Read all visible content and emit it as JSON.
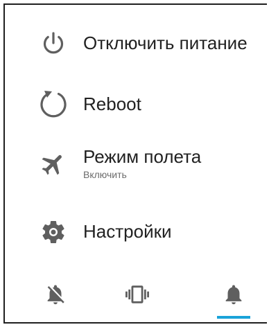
{
  "power_menu": {
    "items": [
      {
        "label": "Отключить питание",
        "icon": "power-icon"
      },
      {
        "label": "Reboot",
        "icon": "reboot-icon"
      },
      {
        "label": "Режим полета",
        "sublabel": "Включить",
        "icon": "airplane-icon"
      },
      {
        "label": "Настройки",
        "icon": "settings-icon"
      }
    ],
    "sound_modes": [
      {
        "name": "silent",
        "icon": "bell-off-icon"
      },
      {
        "name": "vibrate",
        "icon": "vibrate-icon"
      },
      {
        "name": "sound",
        "icon": "bell-icon",
        "selected": true
      }
    ],
    "colors": {
      "icon": "#616161",
      "text": "#212121",
      "accent": "#1aa3d9"
    }
  }
}
